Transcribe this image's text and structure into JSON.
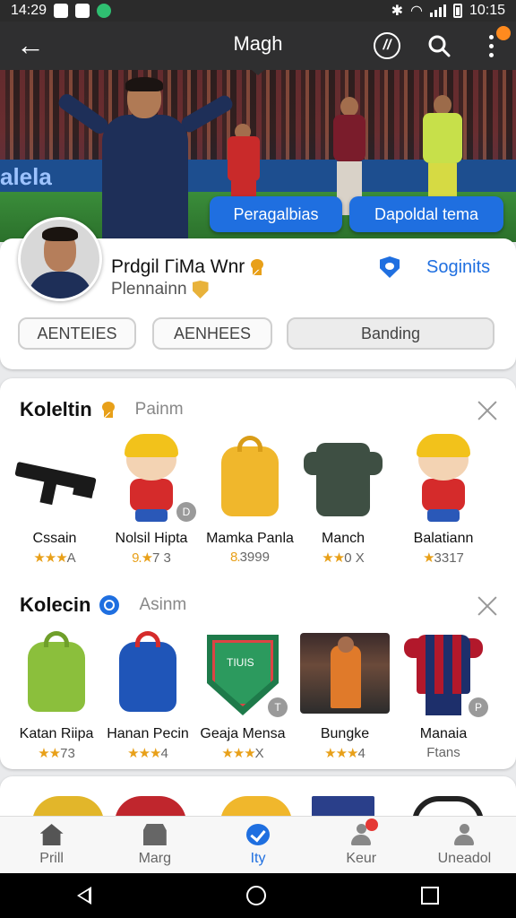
{
  "status_bar": {
    "time": "14:29",
    "clock_right": "10:15"
  },
  "app_bar": {
    "title": "Magh",
    "rank_icon": "rank-badge-icon",
    "search_icon": "search-icon",
    "more_icon": "more-vert-icon"
  },
  "banner": {
    "ad_text": "alela",
    "buttons": [
      "Peragalbias",
      "Dapoldal tema"
    ]
  },
  "profile": {
    "name": "Prdgil ΓiMa Wnr",
    "subtitle": "Plennainn",
    "signin_label": "Soginits",
    "chips": [
      "AENTEIES",
      "AENHEES",
      "Banding"
    ]
  },
  "sections": [
    {
      "title": "Koleltin",
      "subtitle": "Painm",
      "items": [
        {
          "name": "Cssain",
          "stars": "★★★",
          "rating": "A",
          "icon": "rifle-icon"
        },
        {
          "name": "Nolsil Hipta",
          "stars": "9.★",
          "rating": "7 3",
          "icon": "mascot-doll-icon",
          "badge": "D"
        },
        {
          "name": "Mamka Panla",
          "stars": "8.",
          "rating": "3999",
          "icon": "yellow-backpack-icon"
        },
        {
          "name": "Manch",
          "stars": "★★",
          "rating": "0 X",
          "icon": "armor-vest-icon"
        },
        {
          "name": "Balatiann",
          "stars": "★",
          "rating": "3317",
          "icon": "mascot-doll-icon"
        }
      ]
    },
    {
      "title": "Kolecin",
      "subtitle": "Asinm",
      "items": [
        {
          "name": "Katan Riipa",
          "stars": "★★",
          "rating": "73",
          "icon": "green-backpack-icon"
        },
        {
          "name": "Hanan Pecin",
          "stars": "★★★",
          "rating": "4",
          "icon": "blue-backpack-icon"
        },
        {
          "name": "Geaja Mensa",
          "stars": "★★★",
          "rating": "X",
          "icon": "club-crest-icon",
          "crest_text": "TIUIS",
          "badge": "T"
        },
        {
          "name": "Bungke",
          "stars": "★★★",
          "rating": "4",
          "icon": "player-photo-icon"
        },
        {
          "name": "Manaia",
          "stars": "",
          "rating": "Ftans",
          "icon": "jersey-doll-icon",
          "badge": "P"
        }
      ]
    }
  ],
  "bottom_nav": [
    {
      "label": "Prill",
      "icon": "home-icon"
    },
    {
      "label": "Marg",
      "icon": "store-icon"
    },
    {
      "label": "Ity",
      "icon": "check-circle-icon",
      "active": true
    },
    {
      "label": "Keur",
      "icon": "user-icon"
    },
    {
      "label": "Uneadol",
      "icon": "user-icon"
    }
  ],
  "colors": {
    "accent": "#1f6fe0",
    "star": "#e8a019",
    "appbar": "#2f2f30"
  }
}
